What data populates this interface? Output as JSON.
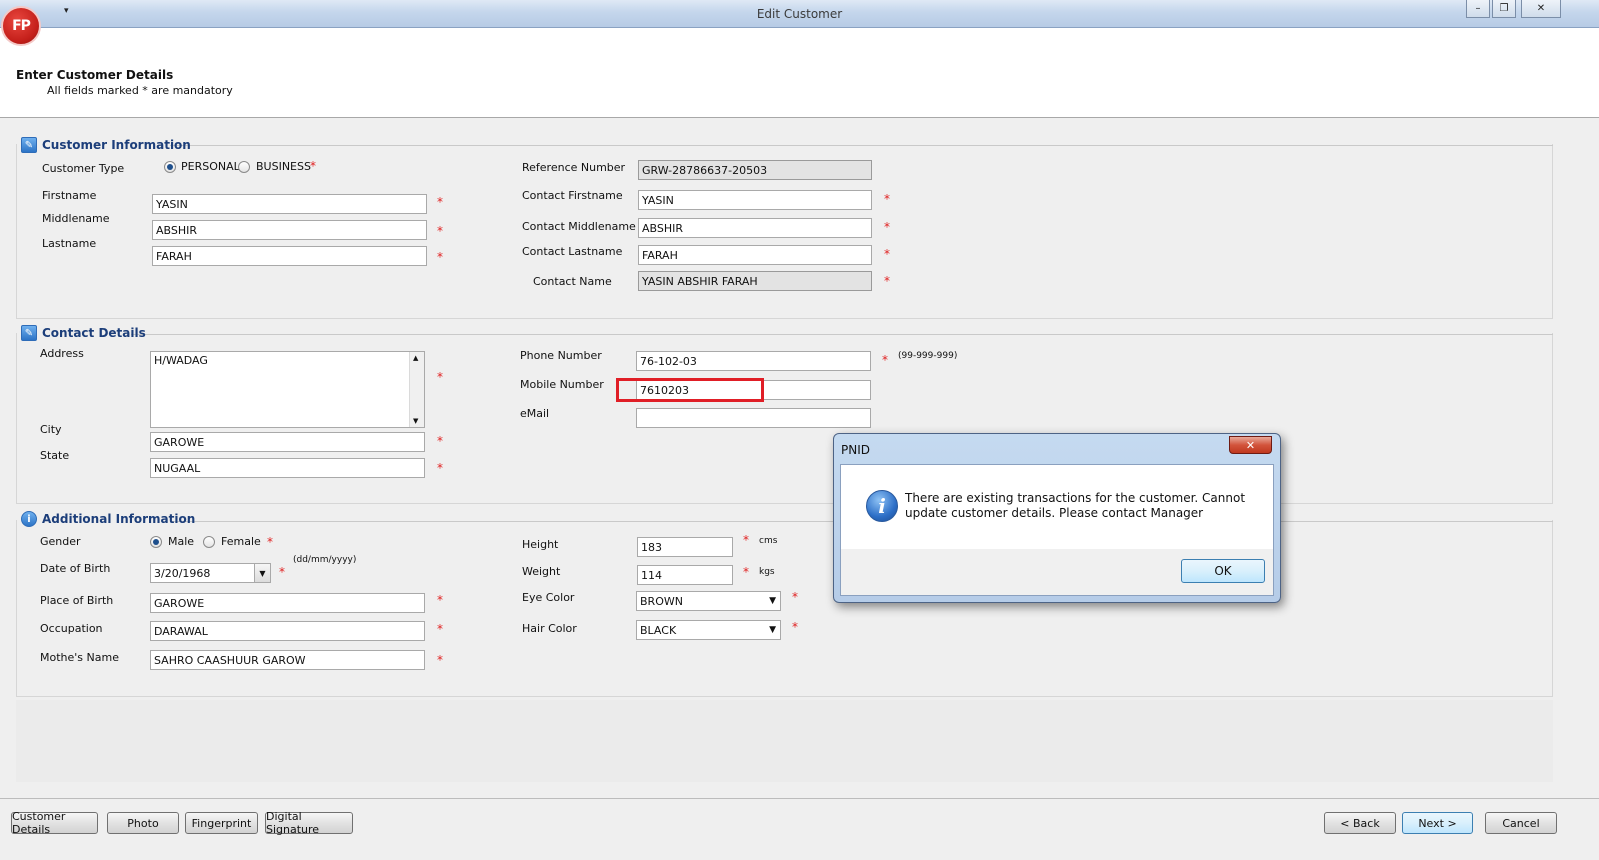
{
  "window": {
    "title": "Edit Customer",
    "logo_text": "FP",
    "quick_access": "▾",
    "min": "–",
    "restore": "❐",
    "close": "✕"
  },
  "header": {
    "title": "Enter Customer Details",
    "subtitle": "All fields marked * are mandatory"
  },
  "customer_info": {
    "title": "Customer Information",
    "customer_type_label": "Customer Type",
    "type_personal": "PERSONAL",
    "type_business": "BUSINESS",
    "selected_type": "PERSONAL",
    "firstname_label": "Firstname",
    "middlename_label": "Middlename",
    "lastname_label": "Lastname",
    "firstname": "YASIN",
    "middlename": "ABSHIR",
    "lastname": "FARAH",
    "reference_label": "Reference Number",
    "reference": "GRW-28786637-20503",
    "contact_firstname_label": "Contact Firstname",
    "contact_firstname": "YASIN",
    "contact_middlename_label": "Contact Middlename",
    "contact_middlename": "ABSHIR",
    "contact_lastname_label": "Contact Lastname",
    "contact_lastname": "FARAH",
    "contact_name_label": "Contact Name",
    "contact_name": "YASIN ABSHIR FARAH"
  },
  "contact_details": {
    "title": "Contact Details",
    "address_label": "Address",
    "address": "H/WADAG",
    "city_label": "City",
    "city": "GAROWE",
    "state_label": "State",
    "state": "NUGAAL",
    "phone_label": "Phone Number",
    "phone": "76-102-03",
    "phone_hint": "(99-999-999)",
    "mobile_label": "Mobile Number",
    "mobile": "7610203",
    "email_label": "eMail",
    "email": ""
  },
  "additional_info": {
    "title": "Additional Information",
    "gender_label": "Gender",
    "gender_male": "Male",
    "gender_female": "Female",
    "selected_gender": "Male",
    "dob_label": "Date of Birth",
    "dob": "3/20/1968",
    "dob_hint": "(dd/mm/yyyy)",
    "pob_label": "Place of Birth",
    "pob": "GAROWE",
    "occupation_label": "Occupation",
    "occupation": "DARAWAL",
    "mother_label": "Mothe's Name",
    "mother": "SAHRO CAASHUUR GAROW",
    "height_label": "Height",
    "height": "183",
    "height_unit": "cms",
    "weight_label": "Weight",
    "weight": "114",
    "weight_unit": "kgs",
    "eye_label": "Eye Color",
    "eye": "BROWN",
    "hair_label": "Hair Color",
    "hair": "BLACK"
  },
  "footer": {
    "tab_customer_details": "Customer Details",
    "tab_photo": "Photo",
    "tab_fingerprint": "Fingerprint",
    "tab_signature": "Digital Signature",
    "back": "< Back",
    "next": "Next >",
    "cancel": "Cancel"
  },
  "dialog": {
    "title": "PNID",
    "message": "There are existing transactions for the customer. Cannot update customer details. Please contact Manager",
    "ok": "OK",
    "close": "✕"
  },
  "colors": {
    "accent": "#1c3e7a",
    "required": "#e02020",
    "highlight": "#e01e26"
  }
}
